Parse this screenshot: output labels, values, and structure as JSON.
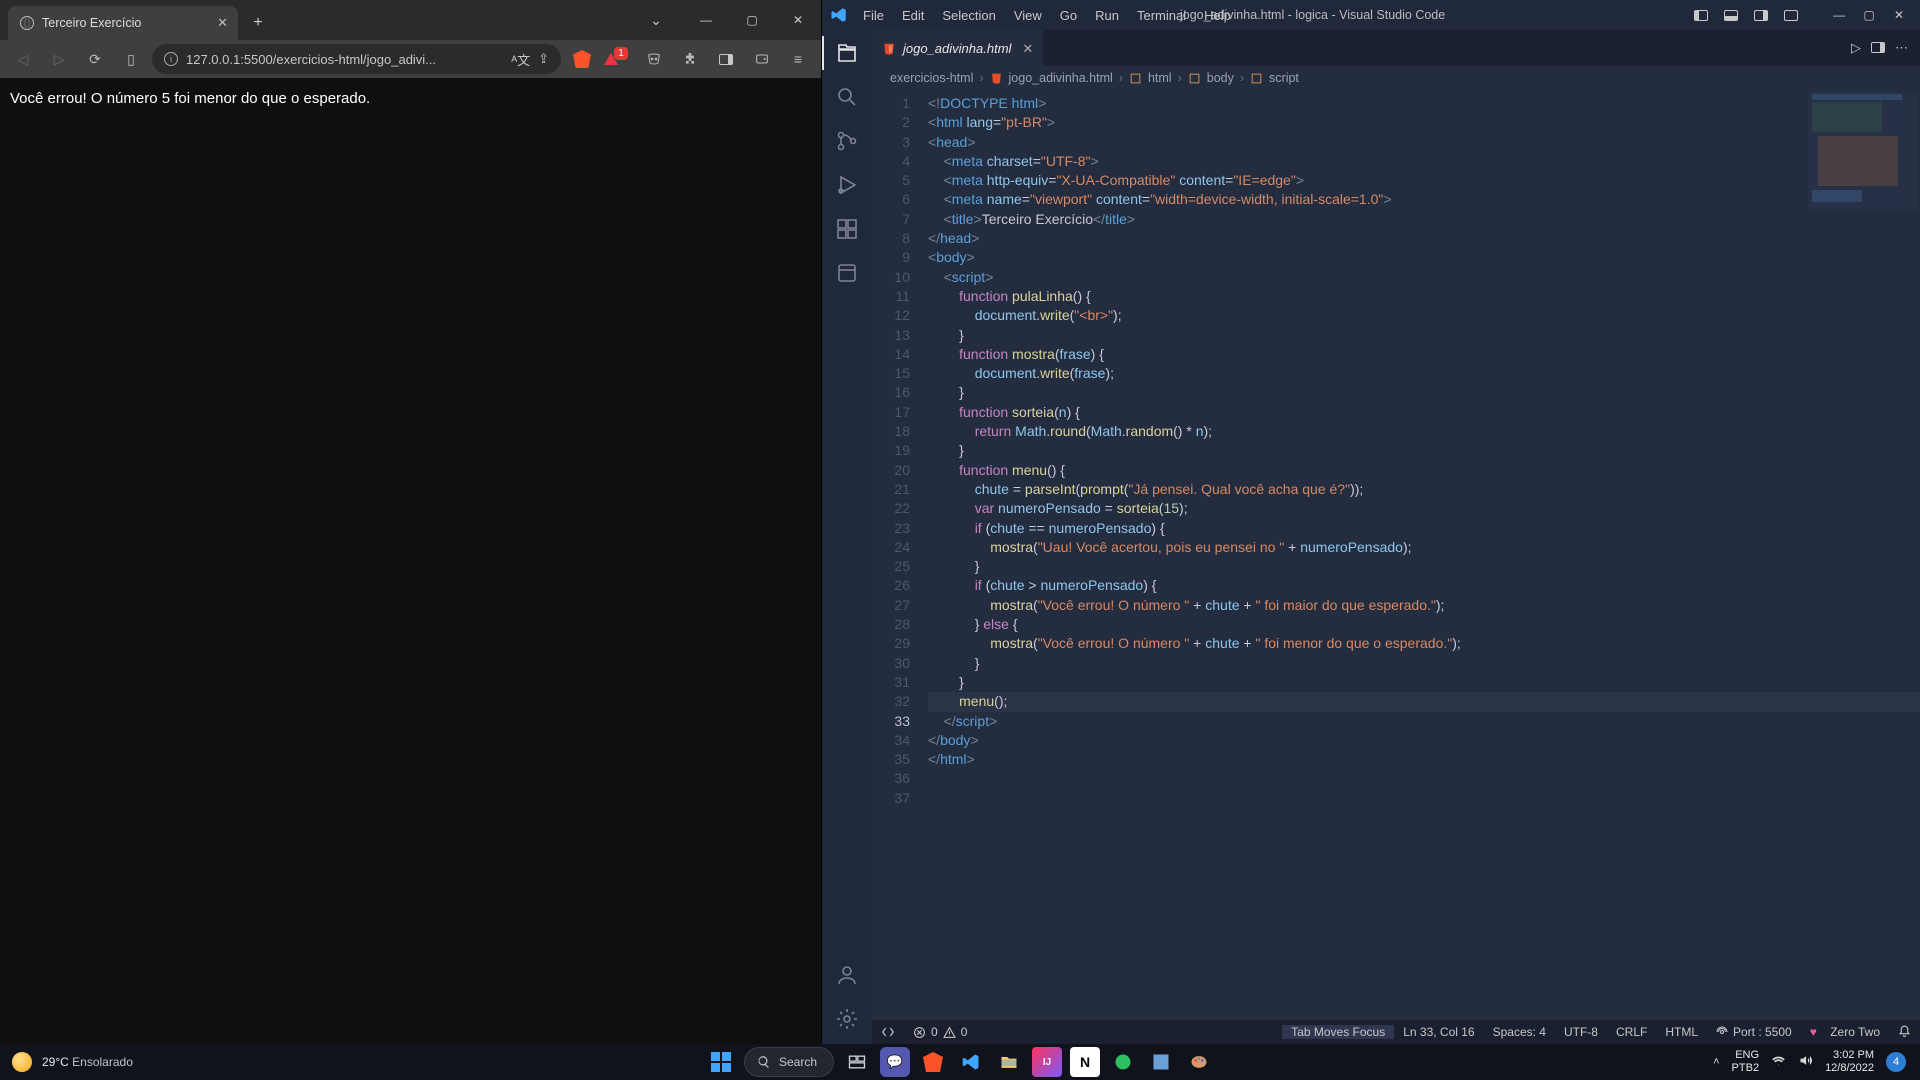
{
  "browser": {
    "tab_title": "Terceiro Exercício",
    "url": "127.0.0.1:5500/exercicios-html/jogo_adivi...",
    "page_text": "Você errou! O número 5 foi menor do que o esperado.",
    "shield_badge": "1"
  },
  "vscode": {
    "window_title": "jogo_adivinha.html - logica - Visual Studio Code",
    "menu": [
      "File",
      "Edit",
      "Selection",
      "View",
      "Go",
      "Run",
      "Terminal",
      "Help"
    ],
    "tab_label": "jogo_adivinha.html",
    "breadcrumb": {
      "folder": "exercicios-html",
      "file": "jogo_adivinha.html",
      "parts": [
        "html",
        "body",
        "script"
      ]
    },
    "status": {
      "errors": "0",
      "warnings": "0",
      "tabmoves": "Tab Moves Focus",
      "pos": "Ln 33, Col 16",
      "spaces": "Spaces: 4",
      "enc": "UTF-8",
      "eol": "CRLF",
      "lang": "HTML",
      "port": "Port : 5500",
      "theme": "Zero Two",
      "bell": ""
    },
    "code": {
      "l1a": "<!",
      "l1b": "DOCTYPE",
      "l1c": " html",
      "l1d": ">",
      "l2a": "<",
      "l2b": "html",
      "l2c": " lang",
      "l2d": "=",
      "l2e": "\"pt-BR\"",
      "l2f": ">",
      "l3a": "<",
      "l3b": "head",
      "l3c": ">",
      "l4a": "<",
      "l4b": "meta",
      "l4c": " charset",
      "l4d": "=",
      "l4e": "\"UTF-8\"",
      "l4f": ">",
      "l5a": "<",
      "l5b": "meta",
      "l5c": " http-equiv",
      "l5d": "=",
      "l5e": "\"X-UA-Compatible\"",
      "l5f": " content",
      "l5g": "=",
      "l5h": "\"IE=edge\"",
      "l5i": ">",
      "l6a": "<",
      "l6b": "meta",
      "l6c": " name",
      "l6d": "=",
      "l6e": "\"viewport\"",
      "l6f": " content",
      "l6g": "=",
      "l6h": "\"width=device-width, initial-scale=1.0\"",
      "l6i": ">",
      "l7a": "<",
      "l7b": "title",
      "l7c": ">",
      "l7d": "Terceiro Exercício",
      "l7e": "</",
      "l7f": "title",
      "l7g": ">",
      "l8a": "</",
      "l8b": "head",
      "l8c": ">",
      "l9a": "<",
      "l9b": "body",
      "l9c": ">",
      "l10a": "<",
      "l10b": "script",
      "l10c": ">",
      "l11a": "function",
      "l11b": " pulaLinha",
      "l11c": "() {",
      "l12a": "document",
      "l12b": ".",
      "l12c": "write",
      "l12d": "(",
      "l12e": "\"<br>\"",
      "l12f": ");",
      "l13a": "}",
      "l14a": "function",
      "l14b": " mostra",
      "l14c": "(",
      "l14d": "frase",
      "l14e": ") {",
      "l15a": "document",
      "l15b": ".",
      "l15c": "write",
      "l15d": "(",
      "l15e": "frase",
      "l15f": ");",
      "l16a": "}",
      "l17a": "function",
      "l17b": " sorteia",
      "l17c": "(",
      "l17d": "n",
      "l17e": ") {",
      "l18a": "return ",
      "l18b": "Math",
      "l18c": ".",
      "l18d": "round",
      "l18e": "(",
      "l18f": "Math",
      "l18g": ".",
      "l18h": "random",
      "l18i": "() * ",
      "l18j": "n",
      "l18k": ");",
      "l19a": "}",
      "l20a": "function",
      "l20b": " menu",
      "l20c": "() {",
      "l21a": "chute",
      "l21b": " = ",
      "l21c": "parseInt",
      "l21d": "(",
      "l21e": "prompt",
      "l21f": "(",
      "l21g": "\"Já pensei. Qual você acha que é?\"",
      "l21h": "));",
      "l22a": "var ",
      "l22b": "numeroPensado",
      "l22c": " = ",
      "l22d": "sorteia",
      "l22e": "(",
      "l22f": "15",
      "l22g": ");",
      "l23a": "if ",
      "l23b": "(",
      "l23c": "chute",
      "l23d": " == ",
      "l23e": "numeroPensado",
      "l23f": ") {",
      "l24a": "mostra",
      "l24b": "(",
      "l24c": "\"Uau! Você acertou, pois eu pensei no \"",
      "l24d": " + ",
      "l24e": "numeroPensado",
      "l24f": ");",
      "l25a": "}",
      "l26a": "if ",
      "l26b": "(",
      "l26c": "chute",
      "l26d": " > ",
      "l26e": "numeroPensado",
      "l26f": ") {",
      "l27a": "mostra",
      "l27b": "(",
      "l27c": "\"Você errou! O número \"",
      "l27d": " + ",
      "l27e": "chute",
      "l27f": " + ",
      "l27g": "\" foi maior do que esperado.\"",
      "l27h": ");",
      "l28a": "} ",
      "l28b": "else",
      "l28c": " {",
      "l29a": "mostra",
      "l29b": "(",
      "l29c": "\"Você errou! O número \"",
      "l29d": " + ",
      "l29e": "chute",
      "l29f": " + ",
      "l29g": "\" foi menor do que o esperado.\"",
      "l29h": ");",
      "l30a": "}",
      "l31a": "}",
      "l33a": "menu",
      "l33b": "();",
      "l35a": "</",
      "l35b": "script",
      "l35c": ">",
      "l36a": "</",
      "l36b": "body",
      "l36c": ">",
      "l37a": "</",
      "l37b": "html",
      "l37c": ">"
    }
  },
  "taskbar": {
    "temp": "29°C",
    "weather": "Ensolarado",
    "search": "Search",
    "lang1": "ENG",
    "lang2": "PTB2",
    "time": "3:02 PM",
    "date": "12/8/2022",
    "notif": "4"
  }
}
